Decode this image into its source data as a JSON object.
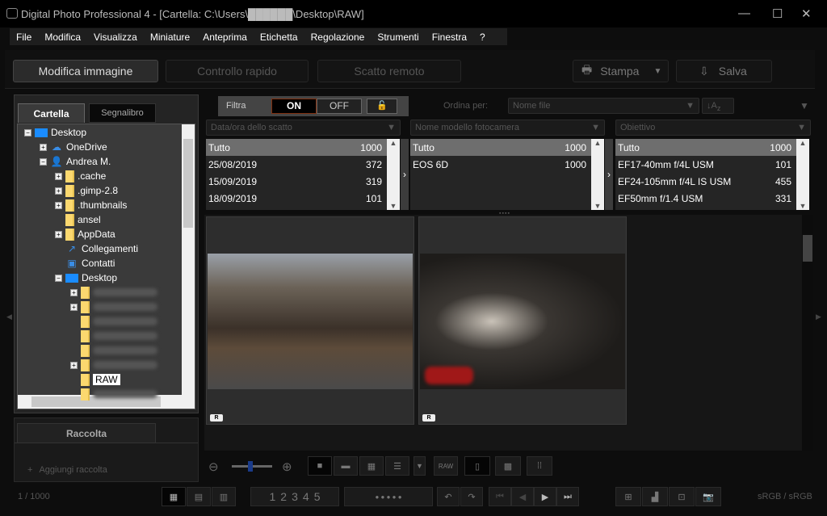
{
  "window": {
    "title": "Digital Photo Professional 4 - [Cartella: C:\\Users\\██████\\Desktop\\RAW]",
    "minimize": "—",
    "maximize": "☐",
    "close": "✕"
  },
  "menu": [
    "File",
    "Modifica",
    "Visualizza",
    "Miniature",
    "Anteprima",
    "Etichetta",
    "Regolazione",
    "Strumenti",
    "Finestra",
    "?"
  ],
  "toolbar": {
    "modes": [
      "Modifica immagine",
      "Controllo rapido",
      "Scatto remoto"
    ],
    "print": "Stampa",
    "save": "Salva"
  },
  "left": {
    "tabs": [
      "Cartella",
      "Segnalibro"
    ],
    "tree": [
      {
        "label": "Desktop",
        "icon": "desktop",
        "depth": 0,
        "toggle": "−"
      },
      {
        "label": "OneDrive",
        "icon": "cloud",
        "depth": 1,
        "toggle": "+"
      },
      {
        "label": "Andrea M.",
        "icon": "user",
        "depth": 1,
        "toggle": "−"
      },
      {
        "label": ".cache",
        "icon": "folder",
        "depth": 2,
        "toggle": "+"
      },
      {
        "label": ".gimp-2.8",
        "icon": "folder",
        "depth": 2,
        "toggle": "+"
      },
      {
        "label": ".thumbnails",
        "icon": "folder",
        "depth": 2,
        "toggle": "+"
      },
      {
        "label": "ansel",
        "icon": "folder",
        "depth": 2,
        "toggle": ""
      },
      {
        "label": "AppData",
        "icon": "folder",
        "depth": 2,
        "toggle": "+"
      },
      {
        "label": "Collegamenti",
        "icon": "shortcut",
        "depth": 2,
        "toggle": ""
      },
      {
        "label": "Contatti",
        "icon": "contacts",
        "depth": 2,
        "toggle": ""
      },
      {
        "label": "Desktop",
        "icon": "desktop",
        "depth": 2,
        "toggle": "−"
      },
      {
        "label": "",
        "icon": "folder",
        "depth": 3,
        "toggle": "+"
      },
      {
        "label": "",
        "icon": "folder",
        "depth": 3,
        "toggle": "+"
      },
      {
        "label": "",
        "icon": "folder",
        "depth": 3,
        "toggle": ""
      },
      {
        "label": "",
        "icon": "folder",
        "depth": 3,
        "toggle": ""
      },
      {
        "label": "",
        "icon": "folder",
        "depth": 3,
        "toggle": ""
      },
      {
        "label": "",
        "icon": "folder",
        "depth": 3,
        "toggle": "+"
      },
      {
        "label": "RAW",
        "icon": "folder",
        "depth": 3,
        "toggle": "",
        "selected": true
      },
      {
        "label": "",
        "icon": "folder",
        "depth": 3,
        "toggle": ""
      }
    ],
    "collection": {
      "title": "Raccolta",
      "add": "Aggiungi raccolta"
    }
  },
  "filter": {
    "label": "Filtra",
    "on": "ON",
    "off": "OFF",
    "sort_label": "Ordina per:",
    "sort_value": "Nome file",
    "columns": [
      {
        "header": "Data/ora dello scatto",
        "rows": [
          [
            "Tutto",
            "1000"
          ],
          [
            "25/08/2019",
            "372"
          ],
          [
            "15/09/2019",
            "319"
          ],
          [
            "18/09/2019",
            "101"
          ]
        ]
      },
      {
        "header": "Nome modello fotocamera",
        "rows": [
          [
            "Tutto",
            "1000"
          ],
          [
            "EOS 6D",
            "1000"
          ]
        ]
      },
      {
        "header": "Obiettivo",
        "rows": [
          [
            "Tutto",
            "1000"
          ],
          [
            "EF17-40mm f/4L USM",
            "101"
          ],
          [
            "EF24-105mm f/4L IS USM",
            "455"
          ],
          [
            "EF50mm f/1.4 USM",
            "331"
          ]
        ]
      }
    ]
  },
  "thumbs": [
    {
      "badge": "R"
    },
    {
      "badge": "R"
    }
  ],
  "bottom": {
    "raw_jpeg": "RAW",
    "counter": "1 / 1000",
    "ratings": [
      "1",
      "2",
      "3",
      "4",
      "5"
    ],
    "colorspace": "sRGB / sRGB"
  },
  "zoom_slider": 0.4
}
